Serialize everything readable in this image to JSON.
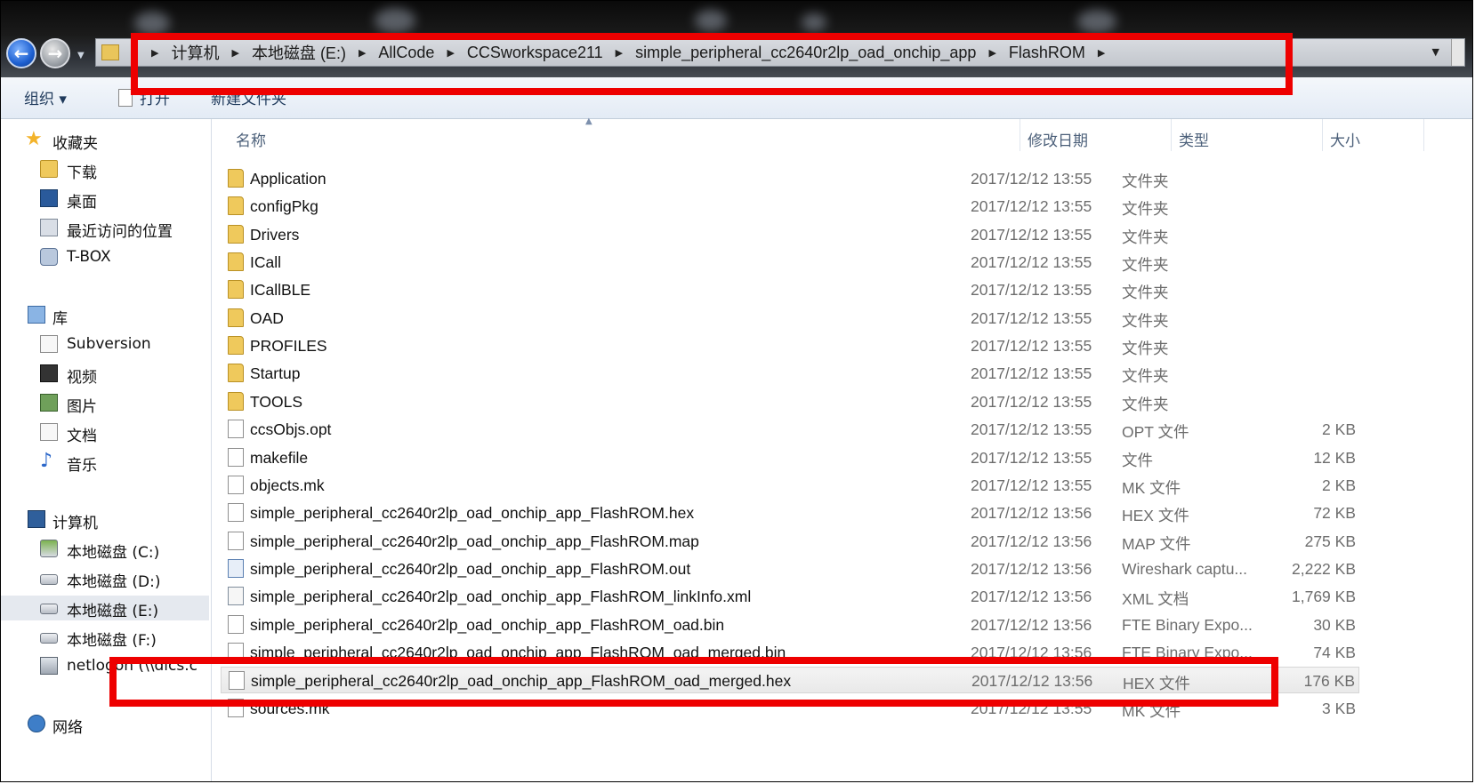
{
  "address": {
    "crumbs": [
      "计算机",
      "本地磁盘 (E:)",
      "AllCode",
      "CCSworkspace211",
      "simple_peripheral_cc2640r2lp_oad_onchip_app",
      "FlashROM"
    ]
  },
  "toolbar": {
    "organize": "组织 ▾",
    "open": "打开",
    "new_folder": "新建文件夹"
  },
  "nav": {
    "favorites": "收藏夹",
    "downloads": "下载",
    "desktop": "桌面",
    "recent": "最近访问的位置",
    "tbox": "T-BOX",
    "libraries": "库",
    "subversion": "Subversion",
    "videos": "视频",
    "pictures": "图片",
    "documents": "文档",
    "music": "音乐",
    "computer": "计算机",
    "drive_c": "本地磁盘 (C:)",
    "drive_d": "本地磁盘 (D:)",
    "drive_e": "本地磁盘 (E:)",
    "drive_f": "本地磁盘 (F:)",
    "netlogon": "netlogon (\\\\dics.c",
    "network": "网络"
  },
  "columns": {
    "name": "名称",
    "modified": "修改日期",
    "type": "类型",
    "size": "大小"
  },
  "files": [
    {
      "name": "Application",
      "date": "2017/12/12 13:55",
      "type": "文件夹",
      "size": "",
      "kind": "folder"
    },
    {
      "name": "configPkg",
      "date": "2017/12/12 13:55",
      "type": "文件夹",
      "size": "",
      "kind": "folder"
    },
    {
      "name": "Drivers",
      "date": "2017/12/12 13:55",
      "type": "文件夹",
      "size": "",
      "kind": "folder"
    },
    {
      "name": "ICall",
      "date": "2017/12/12 13:55",
      "type": "文件夹",
      "size": "",
      "kind": "folder"
    },
    {
      "name": "ICallBLE",
      "date": "2017/12/12 13:55",
      "type": "文件夹",
      "size": "",
      "kind": "folder"
    },
    {
      "name": "OAD",
      "date": "2017/12/12 13:55",
      "type": "文件夹",
      "size": "",
      "kind": "folder"
    },
    {
      "name": "PROFILES",
      "date": "2017/12/12 13:55",
      "type": "文件夹",
      "size": "",
      "kind": "folder"
    },
    {
      "name": "Startup",
      "date": "2017/12/12 13:55",
      "type": "文件夹",
      "size": "",
      "kind": "folder"
    },
    {
      "name": "TOOLS",
      "date": "2017/12/12 13:55",
      "type": "文件夹",
      "size": "",
      "kind": "folder"
    },
    {
      "name": "ccsObjs.opt",
      "date": "2017/12/12 13:55",
      "type": "OPT 文件",
      "size": "2 KB",
      "kind": "file"
    },
    {
      "name": "makefile",
      "date": "2017/12/12 13:55",
      "type": "文件",
      "size": "12 KB",
      "kind": "file"
    },
    {
      "name": "objects.mk",
      "date": "2017/12/12 13:55",
      "type": "MK 文件",
      "size": "2 KB",
      "kind": "file"
    },
    {
      "name": "simple_peripheral_cc2640r2lp_oad_onchip_app_FlashROM.hex",
      "date": "2017/12/12 13:56",
      "type": "HEX 文件",
      "size": "72 KB",
      "kind": "file"
    },
    {
      "name": "simple_peripheral_cc2640r2lp_oad_onchip_app_FlashROM.map",
      "date": "2017/12/12 13:56",
      "type": "MAP 文件",
      "size": "275 KB",
      "kind": "file"
    },
    {
      "name": "simple_peripheral_cc2640r2lp_oad_onchip_app_FlashROM.out",
      "date": "2017/12/12 13:56",
      "type": "Wireshark captu...",
      "size": "2,222 KB",
      "kind": "ws"
    },
    {
      "name": "simple_peripheral_cc2640r2lp_oad_onchip_app_FlashROM_linkInfo.xml",
      "date": "2017/12/12 13:56",
      "type": "XML 文档",
      "size": "1,769 KB",
      "kind": "xml"
    },
    {
      "name": "simple_peripheral_cc2640r2lp_oad_onchip_app_FlashROM_oad.bin",
      "date": "2017/12/12 13:56",
      "type": "FTE Binary Expo...",
      "size": "30 KB",
      "kind": "file"
    },
    {
      "name": "simple_peripheral_cc2640r2lp_oad_onchip_app_FlashROM_oad_merged.bin",
      "date": "2017/12/12 13:56",
      "type": "FTE Binary Expo...",
      "size": "74 KB",
      "kind": "file"
    },
    {
      "name": "simple_peripheral_cc2640r2lp_oad_onchip_app_FlashROM_oad_merged.hex",
      "date": "2017/12/12 13:56",
      "type": "HEX 文件",
      "size": "176 KB",
      "kind": "file",
      "selected": true
    },
    {
      "name": "sources.mk",
      "date": "2017/12/12 13:55",
      "type": "MK 文件",
      "size": "3 KB",
      "kind": "file"
    }
  ],
  "colors": {
    "highlight": "#ee0000",
    "toolbar_text": "#1e395b",
    "secondary_text": "#6d6d6d"
  }
}
